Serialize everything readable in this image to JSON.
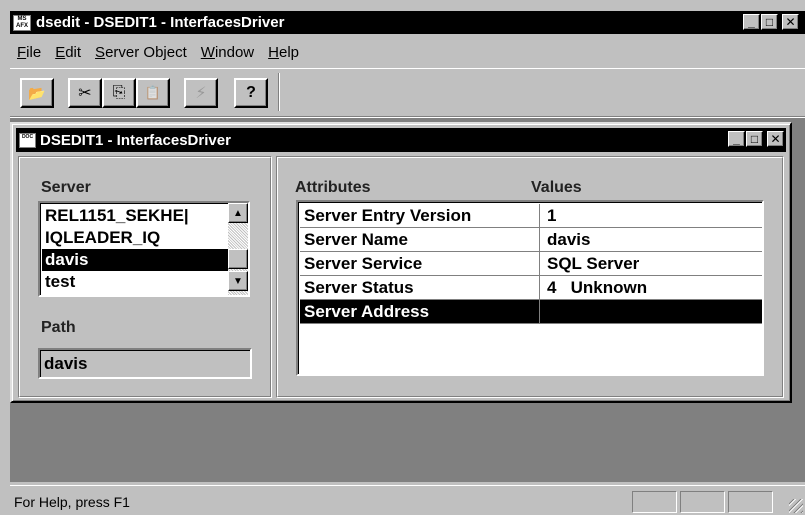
{
  "app": {
    "icon_text": "MS AFX",
    "title": "dsedit - DSEDIT1 - InterfacesDriver",
    "min_label": "_",
    "max_label": "□",
    "close_label": "✕"
  },
  "menu": [
    {
      "first": "F",
      "rest": "ile"
    },
    {
      "first": "E",
      "rest": "dit"
    },
    {
      "first": "S",
      "rest": "erver Object"
    },
    {
      "first": "W",
      "rest": "indow"
    },
    {
      "first": "H",
      "rest": "elp"
    }
  ],
  "toolbar": {
    "open_glyph": "📂",
    "cut_glyph": "✂",
    "copy_glyph": "⎘",
    "paste_glyph": "📋",
    "ping_glyph": "⚡",
    "help_glyph": "?"
  },
  "child_window": {
    "icon_text": "DOC",
    "title": "DSEDIT1 - InterfacesDriver",
    "min_label": "_",
    "max_label": "□",
    "close_label": "✕"
  },
  "server_panel": {
    "server_label": "Server",
    "servers": [
      {
        "name": "REL1151_SEKHE|",
        "selected": false
      },
      {
        "name": "IQLEADER_IQ",
        "selected": false
      },
      {
        "name": "davis",
        "selected": true
      },
      {
        "name": "test",
        "selected": false
      }
    ],
    "scroll_up": "▲",
    "scroll_down": "▼",
    "path_label": "Path",
    "path_value": "davis"
  },
  "attributes_panel": {
    "attributes_header": "Attributes",
    "values_header": "Values",
    "rows": [
      {
        "attribute": "Server Entry Version",
        "value": "1",
        "selected": false
      },
      {
        "attribute": "Server Name",
        "value": "davis",
        "selected": false
      },
      {
        "attribute": "Server Service",
        "value": "SQL Server",
        "selected": false
      },
      {
        "attribute": "Server Status",
        "value": "4   Unknown",
        "selected": false
      },
      {
        "attribute": "Server Address",
        "value": "",
        "selected": true
      }
    ]
  },
  "statusbar": {
    "text": "For Help, press F1"
  }
}
